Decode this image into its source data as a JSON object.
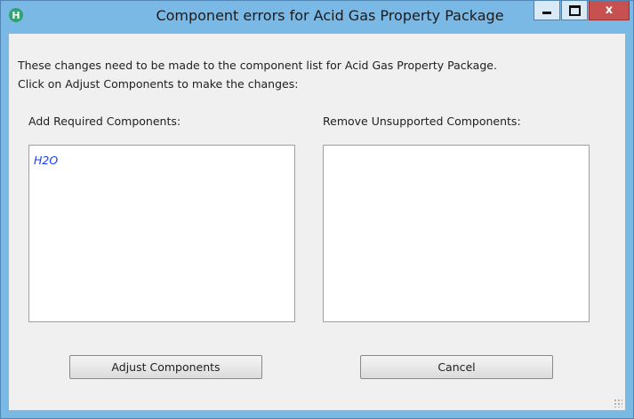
{
  "window": {
    "title": "Component errors for Acid Gas Property Package",
    "app_icon_glyph": "H",
    "controls": {
      "minimize": "minimize",
      "maximize": "maximize",
      "close": "x"
    }
  },
  "instructions": {
    "line1": "These changes need to be made to the component list for Acid Gas Property Package.",
    "line2": "Click on Adjust Components to make the changes:"
  },
  "add_required": {
    "label": "Add Required Components:",
    "items": [
      "H2O"
    ]
  },
  "remove_unsupported": {
    "label": "Remove Unsupported Components:",
    "items": []
  },
  "buttons": {
    "adjust": "Adjust Components",
    "cancel": "Cancel"
  },
  "colors": {
    "frame": "#7ab8e6",
    "client": "#f0f0f0",
    "item_text": "#1a3cff",
    "close_button": "#c75050"
  }
}
